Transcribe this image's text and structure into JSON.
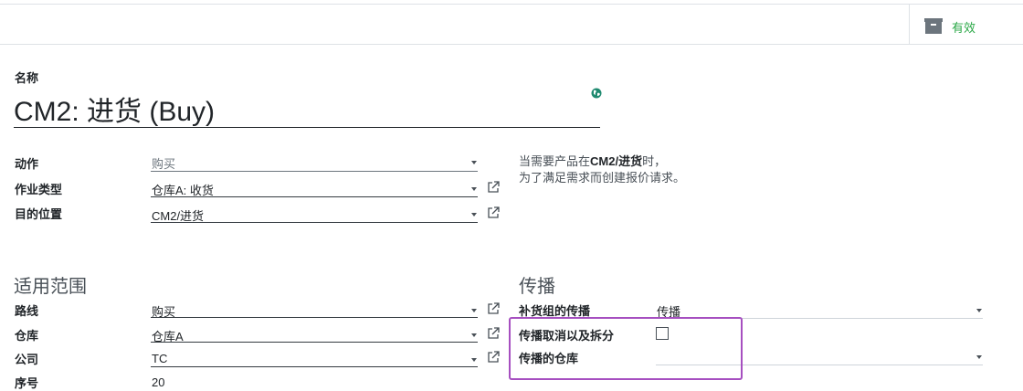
{
  "status_button": {
    "label": "有效",
    "icon": "archive-icon"
  },
  "name": {
    "label": "名称",
    "value": "CM2: 进货 (Buy)"
  },
  "fields": {
    "action": {
      "label": "动作",
      "value": "购买"
    },
    "operation_type": {
      "label": "作业类型",
      "value": "仓库A: 收货"
    },
    "destination": {
      "label": "目的位置",
      "value": "CM2/进货"
    }
  },
  "help": {
    "line1_prefix": "当需要产品在",
    "line1_bold": "CM2/进货",
    "line1_suffix": "时，",
    "line2": "为了满足需求而创建报价请求。"
  },
  "applicability": {
    "title": "适用范围",
    "route": {
      "label": "路线",
      "value": "购买"
    },
    "warehouse": {
      "label": "仓库",
      "value": "仓库A"
    },
    "company": {
      "label": "公司",
      "value": "TC"
    },
    "sequence": {
      "label": "序号",
      "value": "20"
    }
  },
  "propagation": {
    "title": "传播",
    "group": {
      "label": "补货组的传播",
      "value": "传播"
    },
    "cancel_split": {
      "label": "传播取消以及拆分",
      "checked": false
    },
    "warehouse": {
      "label": "传播的仓库",
      "value": ""
    }
  }
}
